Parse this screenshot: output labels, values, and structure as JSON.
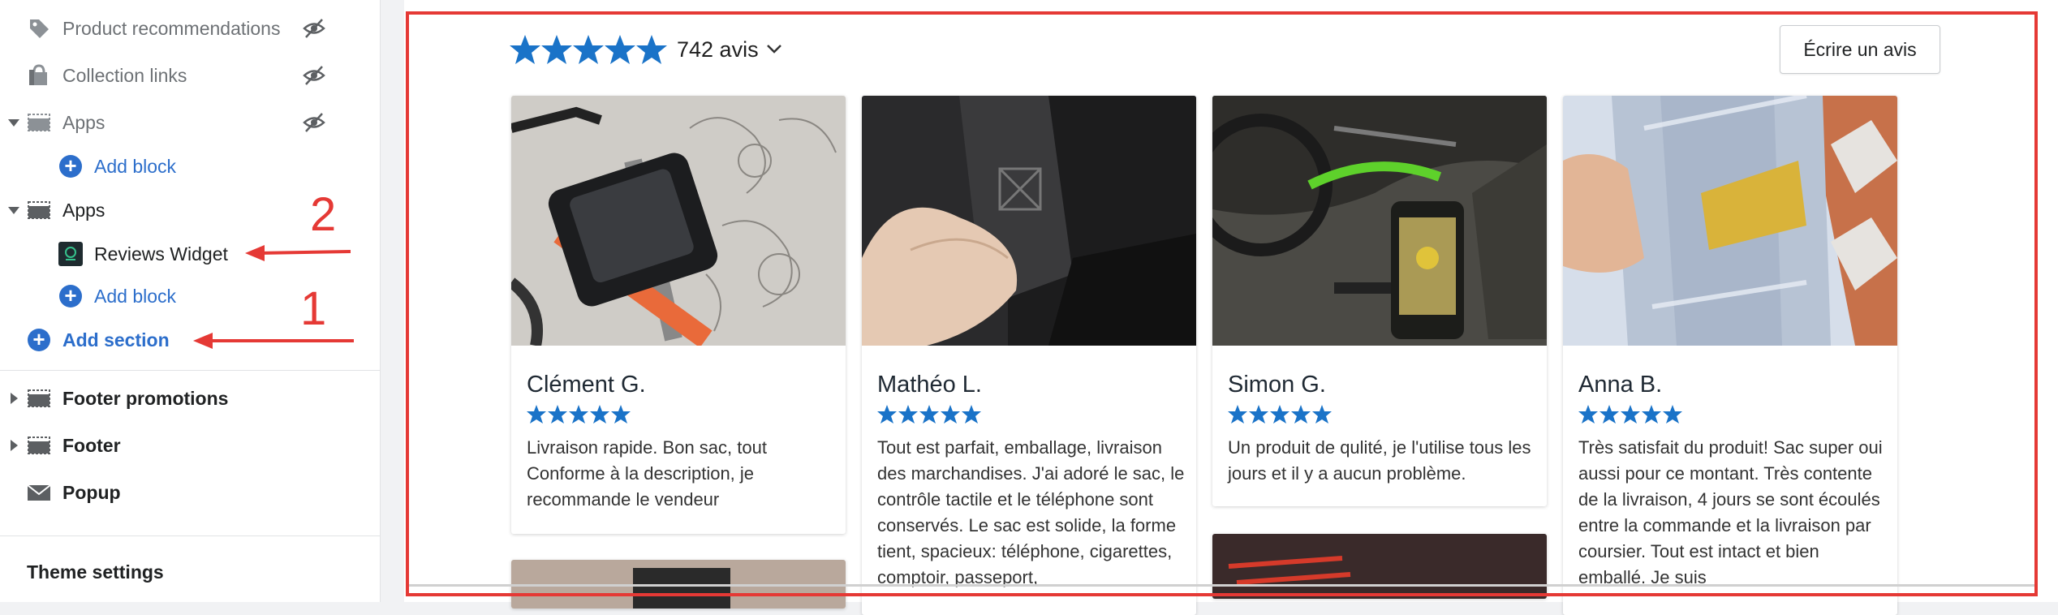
{
  "sidebar": {
    "items": [
      {
        "label": "Product recommendations",
        "icon": "tag-icon",
        "hidden": true
      },
      {
        "label": "Collection links",
        "icon": "collection-icon",
        "hidden": true
      },
      {
        "label": "Apps",
        "icon": "section-icon",
        "hidden": true,
        "expanded": true
      },
      {
        "label": "Add block"
      },
      {
        "label": "Apps",
        "icon": "section-icon",
        "expanded": true
      },
      {
        "label": "Reviews Widget",
        "icon": "app-icon"
      },
      {
        "label": "Add block"
      },
      {
        "label": "Add section"
      },
      {
        "label": "Footer promotions",
        "icon": "section-icon",
        "expanded": false
      },
      {
        "label": "Footer",
        "icon": "section-icon",
        "expanded": false
      },
      {
        "label": "Popup",
        "icon": "mail-icon"
      }
    ],
    "theme_settings": "Theme settings"
  },
  "annotations": {
    "arrow1": "1",
    "arrow2": "2",
    "color": "#e53935"
  },
  "widget": {
    "rating_stars": 5,
    "count_label": "742 avis",
    "write_button": "Écrire un avis",
    "star_color": "#1a73c8",
    "reviews": [
      {
        "author": "Clément G.",
        "stars": 5,
        "text": "Livraison rapide. Bon sac, tout Conforme à la description, je recommande le vendeur"
      },
      {
        "author": "Mathéo L.",
        "stars": 5,
        "text": "Tout est parfait, emballage, livraison des marchandises. J'ai adoré le sac, le contrôle tactile et le téléphone sont conservés. Le sac est solide, la forme tient, spacieux: téléphone, cigarettes, comptoir, passeport,"
      },
      {
        "author": "Simon G.",
        "stars": 5,
        "text": "Un produit de qulité, je l'utilise tous les jours et il y a aucun problème."
      },
      {
        "author": "Anna B.",
        "stars": 5,
        "text": "Très satisfait du produit! Sac super oui aussi pour ce montant. Très contente de la livraison, 4 jours se sont écoulés entre la commande et la livraison par coursier. Tout est intact et bien emballé. Je suis"
      }
    ]
  }
}
